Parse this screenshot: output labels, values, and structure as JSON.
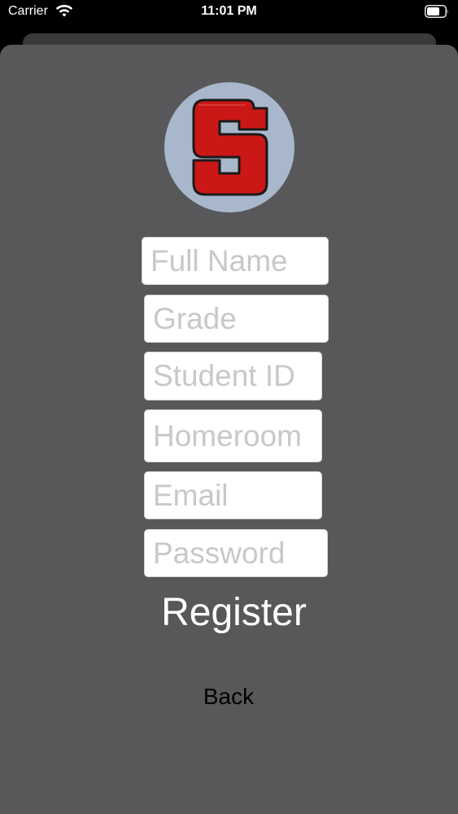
{
  "status_bar": {
    "carrier": "Carrier",
    "time": "11:01 PM",
    "wifi_icon": "wifi-icon",
    "battery_icon": "battery-icon"
  },
  "logo": {
    "icon": "school-s-logo",
    "colors": {
      "circle": "#a9b7cc",
      "letter_fill": "#cc1717",
      "letter_outline": "#1a1a1a"
    }
  },
  "form": {
    "full_name": {
      "placeholder": "Full Name",
      "value": ""
    },
    "grade": {
      "placeholder": "Grade",
      "value": ""
    },
    "student_id": {
      "placeholder": "Student ID",
      "value": ""
    },
    "homeroom": {
      "placeholder": "Homeroom",
      "value": ""
    },
    "email": {
      "placeholder": "Email",
      "value": ""
    },
    "password": {
      "placeholder": "Password",
      "value": ""
    }
  },
  "buttons": {
    "register_label": "Register",
    "back_label": "Back"
  },
  "colors": {
    "background": "#000000",
    "sheet": "#58585a",
    "field_bg": "#ffffff",
    "placeholder": "#c8c8cc",
    "register_text": "#ffffff",
    "back_text": "#000000"
  }
}
